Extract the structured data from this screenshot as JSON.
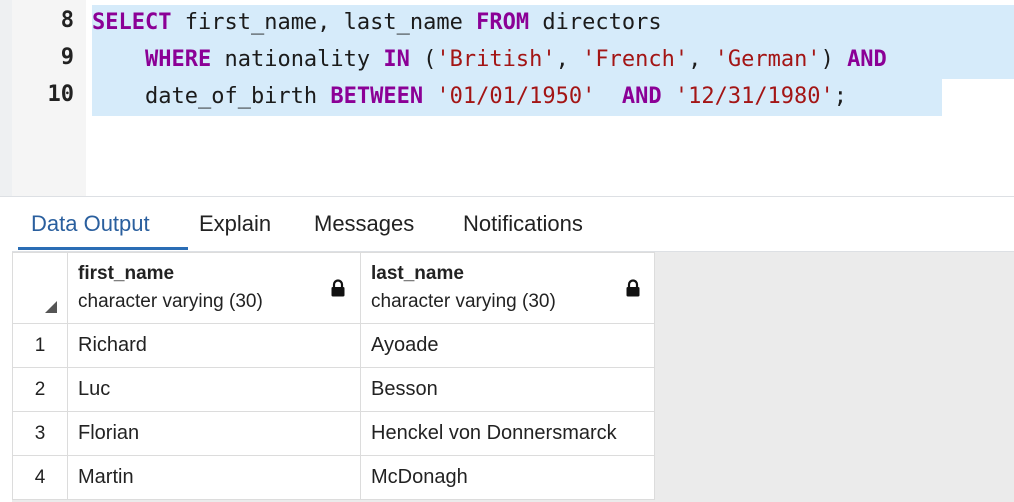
{
  "editor": {
    "line_numbers": [
      "8",
      "9",
      "10"
    ],
    "lines": [
      [
        {
          "t": "SELECT",
          "k": "kw"
        },
        {
          "t": " first_name, last_name ",
          "k": ""
        },
        {
          "t": "FROM",
          "k": "kw"
        },
        {
          "t": " directors",
          "k": ""
        }
      ],
      [
        {
          "t": "    ",
          "k": ""
        },
        {
          "t": "WHERE",
          "k": "kw"
        },
        {
          "t": " nationality ",
          "k": ""
        },
        {
          "t": "IN",
          "k": "kw"
        },
        {
          "t": " (",
          "k": ""
        },
        {
          "t": "'British'",
          "k": "str"
        },
        {
          "t": ", ",
          "k": ""
        },
        {
          "t": "'French'",
          "k": "str"
        },
        {
          "t": ", ",
          "k": ""
        },
        {
          "t": "'German'",
          "k": "str"
        },
        {
          "t": ") ",
          "k": ""
        },
        {
          "t": "AND",
          "k": "kw"
        }
      ],
      [
        {
          "t": "    date_of_birth ",
          "k": ""
        },
        {
          "t": "BETWEEN",
          "k": "kw"
        },
        {
          "t": " ",
          "k": ""
        },
        {
          "t": "'01/01/1950'",
          "k": "str"
        },
        {
          "t": "  ",
          "k": ""
        },
        {
          "t": "AND",
          "k": "kw"
        },
        {
          "t": " ",
          "k": ""
        },
        {
          "t": "'12/31/1980'",
          "k": "str"
        },
        {
          "t": ";",
          "k": ""
        }
      ]
    ],
    "colors": {
      "keyword": "#8b0096",
      "string": "#a31515",
      "selection": "#d6ebfa"
    }
  },
  "tabs": [
    {
      "label": "Data Output",
      "active": true
    },
    {
      "label": "Explain",
      "active": false
    },
    {
      "label": "Messages",
      "active": false
    },
    {
      "label": "Notifications",
      "active": false
    }
  ],
  "grid": {
    "corner_icon": "sort-triangle-icon",
    "columns": [
      {
        "name": "first_name",
        "type": "character varying (30)",
        "icon": "lock-icon"
      },
      {
        "name": "last_name",
        "type": "character varying (30)",
        "icon": "lock-icon"
      }
    ],
    "rows": [
      {
        "num": "1",
        "cells": [
          "Richard",
          "Ayoade"
        ]
      },
      {
        "num": "2",
        "cells": [
          "Luc",
          "Besson"
        ]
      },
      {
        "num": "3",
        "cells": [
          "Florian",
          "Henckel von Donnersmarck"
        ]
      },
      {
        "num": "4",
        "cells": [
          "Martin",
          "McDonagh"
        ]
      }
    ]
  }
}
